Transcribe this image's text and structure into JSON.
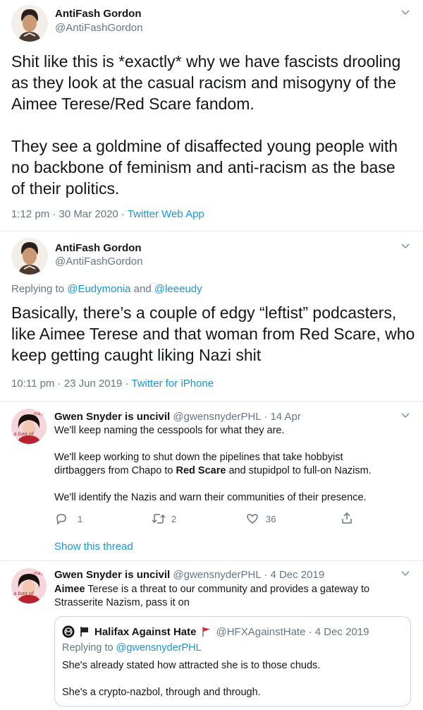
{
  "tweet1": {
    "author_name": "AntiFash Gordon",
    "author_handle": "@AntiFashGordon",
    "para1": [
      "Shit like this is *exactly* why we have fascists drooling",
      "as they look at the casual racism and misogyny of the",
      "Aimee Terese/Red Scare fandom."
    ],
    "para2": [
      "They see a goldmine of disaffected young people with",
      "no backbone of feminism and anti-racism as the base",
      "of their politics."
    ],
    "time": "1:12 pm · 30 Mar 2020 · ",
    "app": "Twitter Web App"
  },
  "tweet2": {
    "author_name": "AntiFash Gordon",
    "author_handle": "@AntiFashGordon",
    "replying_prefix": "Replying to ",
    "reply_user1": "@Eudymonia",
    "reply_and": " and ",
    "reply_user2": "@leeeudy",
    "lines": [
      "Basically, there’s a couple of edgy “leftist” podcasters,",
      "like Aimee Terese and that woman from Red Scare, who",
      "keep getting caught liking Nazi shit"
    ],
    "time": "10:11 pm · 23 Jun 2019 · ",
    "app": "Twitter for iPhone"
  },
  "tweet3": {
    "author_name": "Gwen Snyder is uncivil",
    "author_handle": "@gwensnyderPHL · 14 Apr",
    "line1": "We'll keep naming the cesspools for what they are.",
    "line2": "We'll keep working to shut down the pipelines that take hobbyist",
    "line3_before": "dirtbaggers from Chapo to ",
    "line3_bold": "Red Scare",
    "line3_after": " and stupidpol to full-on Nazism.",
    "line4": "We'll identify the Nazis and warn their communities of their presence.",
    "replies": "1",
    "retweets": "2",
    "likes": "36",
    "show_thread": "Show this thread"
  },
  "tweet4": {
    "author_name": "Gwen Snyder is uncivil",
    "author_handle": "@gwensnyderPHL · 4 Dec 2019",
    "line1_bold": "Aimee",
    "line1_rest": " Terese is a threat to our community and provides a gateway to",
    "line2": "Strasserite Nazism, pass it on",
    "quote": {
      "author_name": "Halifax Against Hate",
      "author_handle": "@HFXAgainstHate · 4 Dec 2019",
      "replying_prefix": "Replying to ",
      "reply_user": "@gwensnyderPHL",
      "line1": "She's already stated how attracted she is to those chuds.",
      "line2": "She's a crypto-nazbol, through and through."
    }
  },
  "colors": {
    "link": "#1b95e0",
    "muted": "#657786",
    "text": "#14171a",
    "border": "#e6ecf0"
  }
}
